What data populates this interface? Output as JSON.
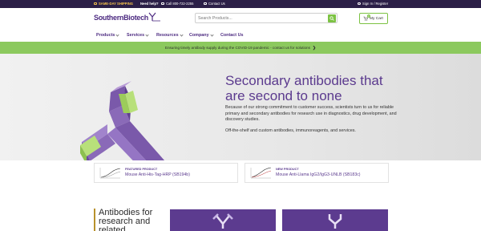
{
  "topbar": {
    "shipping": "SAME-DAY SHIPPING",
    "help": "Need help?",
    "call": "Call 800-722-2255",
    "contact": "Contact Us",
    "signin": "Sign In / Register"
  },
  "header": {
    "logo": "SouthernBiotech",
    "search_placeholder": "Search Products...",
    "cart_label": "My Cart",
    "cart_count": "0"
  },
  "nav": {
    "items": [
      {
        "label": "Products"
      },
      {
        "label": "Services"
      },
      {
        "label": "Resources"
      },
      {
        "label": "Company"
      },
      {
        "label": "Contact Us"
      }
    ]
  },
  "banner": {
    "text": "Ensuring timely antibody supply during the COVID-19 pandemic - contact us for solutions"
  },
  "hero": {
    "title": "Secondary antibodies that are second to none",
    "body": "Because of our strong commitment to customer success, scientists turn to us for reliable primary and secondary antibodies for research use in diagnostics, drug development, and discovery studies.",
    "body2": "Off-the-shelf and custom antibodies, immunoreagents, and services."
  },
  "products": [
    {
      "tag": "FEATURED PRODUCT",
      "name": "Mouse Anti-His-Tag-HRP (SB194b)"
    },
    {
      "tag": "NEW PRODUCT",
      "name": "Mouse Anti-Llama IgG2/IgG3-UNLB (SB183c)"
    }
  ],
  "bottom": {
    "title": "Antibodies for research and related"
  },
  "colors": {
    "brand_purple": "#5b3a8e",
    "accent_green": "#8cc95e",
    "topbar_dark": "#2b1f47"
  }
}
